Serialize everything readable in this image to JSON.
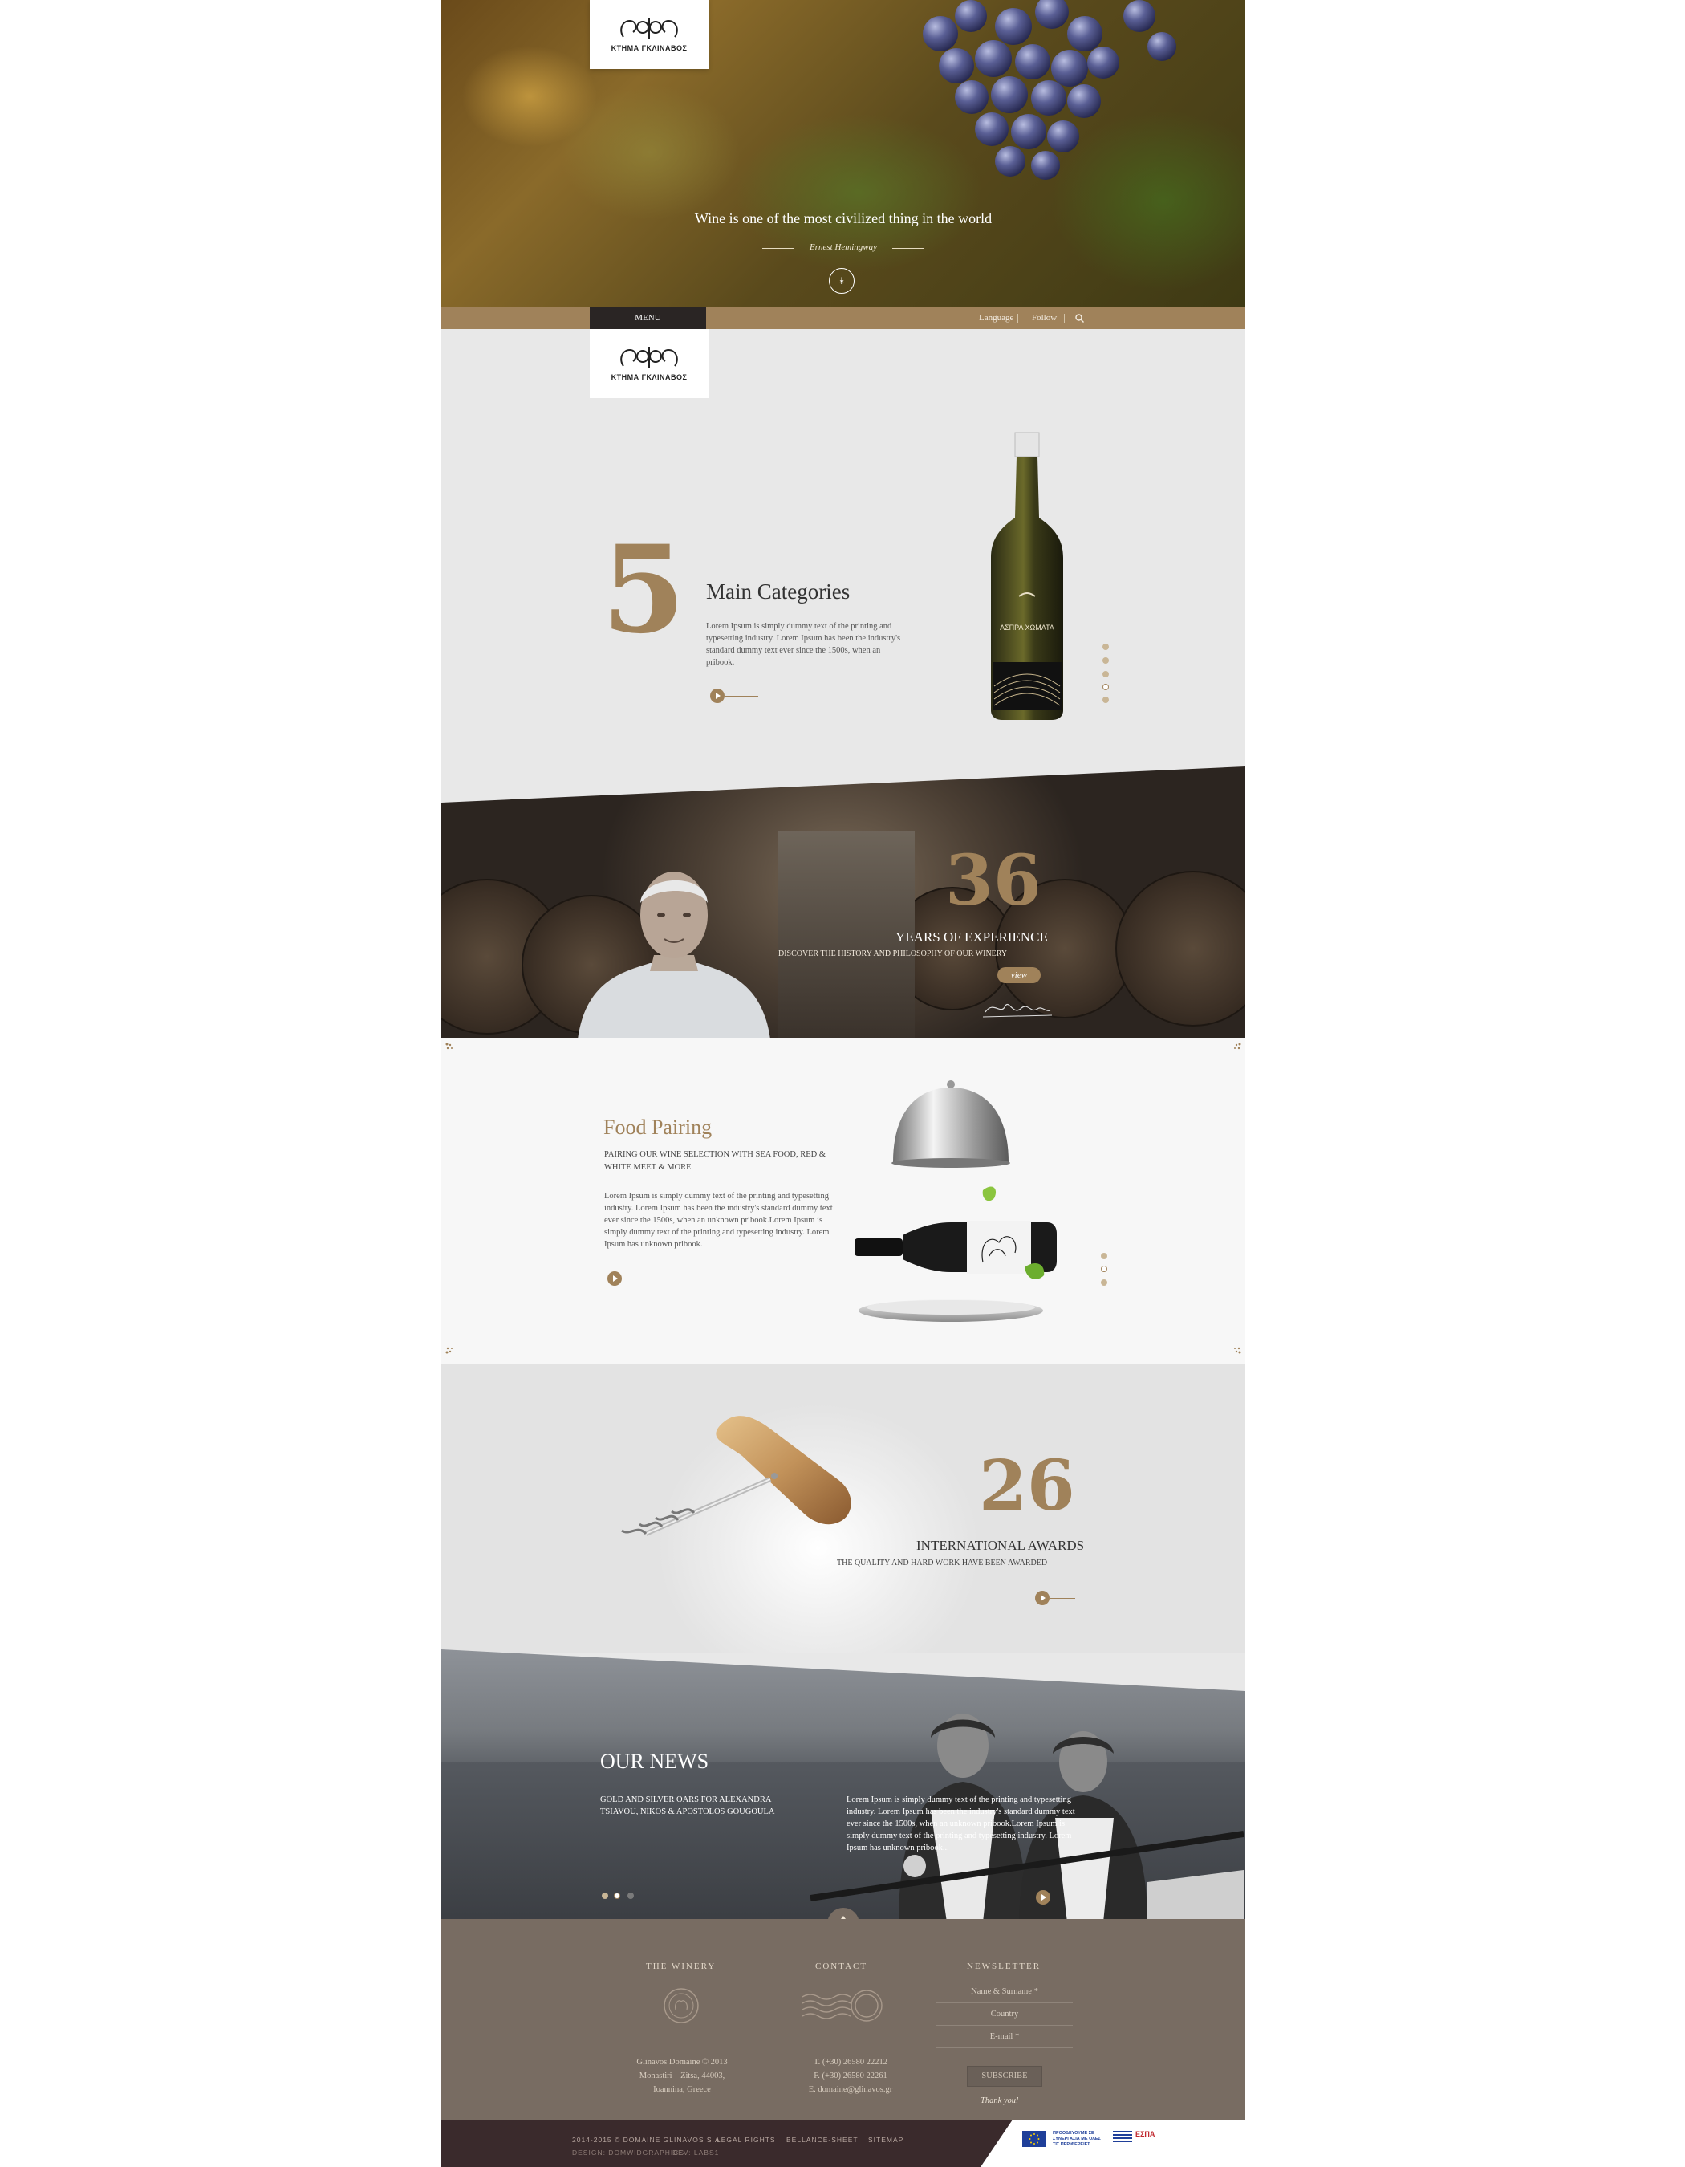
{
  "brand": {
    "logo_text": "ΚΤΗΜΑ ΓΚΛΙΝΑΒΟΣ"
  },
  "hero": {
    "quote": "Wine is one of the most civilized thing in the world",
    "author": "Ernest Hemingway"
  },
  "nav": {
    "menu": "MENU",
    "language": "Language",
    "follow": "Follow"
  },
  "categories": {
    "number": "5",
    "title": "Main Categories",
    "text": "Lorem Ipsum is simply dummy text of the printing and typesetting industry. Lorem Ipsum has been the industry's standard dummy text ever since the 1500s, when an pribook.",
    "bottle_label": "ΑΣΠΡΑ ΧΩΜΑΤΑ",
    "slides": 5,
    "active_slide": 4
  },
  "experience": {
    "number": "36",
    "title": "YEARS OF EXPERIENCE",
    "subtitle": "DISCOVER THE HISTORY AND PHILOSOPHY OF OUR WINERY",
    "button": "view"
  },
  "food": {
    "title": "Food Pairing",
    "subtitle": "PAIRING OUR WINE SELECTION WITH SEA FOOD, RED & WHITE MEET & MORE",
    "text": "Lorem Ipsum is simply dummy text of the printing and typesetting industry. Lorem Ipsum has been the industry's standard dummy text ever since the 1500s, when an unknown pribook.Lorem Ipsum is simply dummy text of the printing and typesetting industry. Lorem Ipsum has unknown pribook.",
    "slides": 3,
    "active_slide": 2
  },
  "awards": {
    "number": "26",
    "title": "INTERNATIONAL AWARDS",
    "subtitle": "THE QUALITY AND HARD WORK HAVE BEEN AWARDED"
  },
  "news": {
    "title": "OUR NEWS",
    "headline": "GOLD AND SILVER OARS FOR ALEXANDRA TSIAVOU, NIKOS & APOSTOLOS GOUGOULA",
    "text": "Lorem Ipsum is simply dummy text of the printing and typesetting industry. Lorem Ipsum has been the industry's standard dummy text ever since the 1500s, when an unknown pribook.Lorem Ipsum is simply dummy text of the printing and typesetting industry. Lorem Ipsum has unknown pribook...",
    "slides": 3,
    "active_slide": 2
  },
  "footer": {
    "winery_head": "THE WINERY",
    "winery_lines": [
      "Glinavos Domaine © 2013",
      "Monastiri – Zitsa, 44003,",
      "Ioannina, Greece"
    ],
    "contact_head": "CONTACT",
    "contact_lines": [
      "T. (+30) 26580 22212",
      "F. (+30) 26580 22261",
      "E. domaine@glinavos.gr"
    ],
    "newsletter_head": "NEWSLETTER",
    "name_placeholder": "Name & Surname *",
    "country_placeholder": "Country",
    "email_placeholder": "E-mail *",
    "subscribe": "SUBSCRIBE",
    "thanks": "Thank you!"
  },
  "bottom": {
    "copyright": "2014-2015 © DOMAINE GLINAVOS S.A.",
    "legal": "LEGAL RIGHTS",
    "balance": "BELLANCE-SHEET",
    "sitemap": "SITEMAP",
    "design": "DESIGN: DOMWIDGRAPHICS",
    "dev": "DEV: LABS1",
    "espa_text": "ΠΡΟΟΔΕΥΟΥΜΕ ΣΕ ΣΥΝΕΡΓΑΣΙΑ ΜΕ ΟΛΕΣ ΤΙΣ ΠΕΡΙΦΕΡΕΙΕΣ",
    "espa_logo": "ΕΣΠΑ"
  },
  "colors": {
    "accent": "#a0825a",
    "dark": "#2a2524",
    "footer": "#786c62"
  }
}
